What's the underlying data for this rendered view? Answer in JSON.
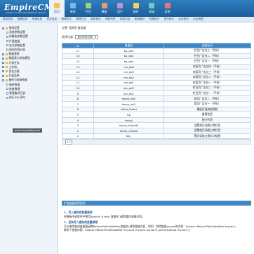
{
  "app": {
    "logo": "EmpireCMS",
    "logo_sub": "Empire Content Management System",
    "topright": ""
  },
  "topnav": [
    {
      "label": "首页",
      "icon": "home-icon",
      "active": true
    },
    {
      "label": "系统",
      "icon": "gear-icon"
    },
    {
      "label": "栏目",
      "icon": "column-icon"
    },
    {
      "label": "模板",
      "icon": "template-icon"
    },
    {
      "label": "用户",
      "icon": "user-icon"
    },
    {
      "label": "插件",
      "icon": "plugin-icon"
    },
    {
      "label": "商城",
      "icon": "shop-icon"
    },
    {
      "label": "其他",
      "icon": "more-icon"
    }
  ],
  "submenu": [
    "增加信息",
    "管理信息",
    "审核信息",
    "签发信息",
    "管理评论",
    "更新栏目",
    "更新首页",
    "更新列表",
    "更新内容",
    "刷新缓存",
    "数据统计",
    "排行统计",
    "后台首页",
    "后台地图"
  ],
  "sidebar": {
    "items": [
      {
        "label": "系统设置",
        "level": 0,
        "kind": "box"
      },
      {
        "label": "系统参数设置",
        "level": 1,
        "kind": "doc"
      },
      {
        "label": "伪静态参数设置",
        "level": 1,
        "kind": "doc"
      },
      {
        "label": "扩展变量",
        "level": 1,
        "kind": "doc"
      },
      {
        "label": "安全参数配置",
        "level": 1,
        "kind": "doc"
      },
      {
        "label": "网站负载分离",
        "level": 1,
        "kind": "doc"
      },
      {
        "label": "数据更新",
        "level": 0,
        "kind": "box"
      },
      {
        "label": "数据表与系统模型",
        "level": 0,
        "kind": "box"
      },
      {
        "label": "计划任务",
        "level": 0,
        "kind": "box"
      },
      {
        "label": "工作流",
        "level": 0,
        "kind": "box"
      },
      {
        "label": "优化方案",
        "level": 0,
        "kind": "box"
      },
      {
        "label": "扩展菜单",
        "level": 0,
        "kind": "box"
      },
      {
        "label": "备份与恢复数据",
        "level": 0,
        "kind": "box"
      },
      {
        "label": "备份数据",
        "level": 1,
        "kind": "doc"
      },
      {
        "label": "恢复数据",
        "level": 1,
        "kind": "doc"
      },
      {
        "label": "管理备份目录",
        "level": 1,
        "kind": "doc"
      },
      {
        "label": "执行SQL语句",
        "level": 1,
        "kind": "doc"
      }
    ],
    "watermark": "www.moyublog.com"
  },
  "main": {
    "breadcrumb": "位置: 管理扩展变量",
    "filter_label": "选择分类:",
    "filter_value": "显示所有分类",
    "columns": [
      "ID",
      "变量名",
      "变量标识"
    ],
    "rows": [
      [
        "17",
        "bo_ad3",
        "栏目广告位三（手机）"
      ],
      [
        "16",
        "bo_ad2",
        "栏目广告位二（手机）"
      ],
      [
        "15",
        "bo_ad1",
        "栏目广告位一（手机）"
      ],
      [
        "14",
        "nei_ad4",
        "内容页广告位四（手机）"
      ],
      [
        "13",
        "nei_ad3",
        "内容页广告位三（手机）"
      ],
      [
        "12",
        "nei_ad2",
        "内容页广告位二（手机）"
      ],
      [
        "11",
        "nei_ad1",
        "内容页广告位一（手机）"
      ],
      [
        "10",
        "lan_ad2",
        "栏目页广告位二（手机）"
      ],
      [
        "9",
        "lan_ad1",
        "栏目页广告位一（手机）"
      ],
      [
        "8",
        "home_ad2",
        "首页广告位二（手机）"
      ],
      [
        "7",
        "home_ad1",
        "首页广告位一（手机）"
      ],
      [
        "6",
        "video_footer",
        "播放页面底部版权"
      ],
      [
        "5",
        "icp",
        "备案信息"
      ],
      [
        "4",
        "tongji",
        "统计代码"
      ],
      [
        "3",
        "home_classid2",
        "设置首页调用分类栏目"
      ],
      [
        "2",
        "home_classid",
        "设置首页调用分类栏目"
      ],
      [
        "1",
        "top_",
        "置站导航右侧文字链接"
      ]
    ],
    "pager": "17"
  },
  "panel": {
    "title": "扩展变量调用说明",
    "line1_head": "1、写入缓存的变量调用",
    "line1": "在模板中或程序中使用$public_r['add_变量名']调用缓存变量内容。",
    "line2_head": "2、没有写入缓存的变量调用",
    "line2": "可以使用查询变量值函数ReturnPublicAddVar(变量名)调用变量内容，例如：取得变量myvar的内容：$value=ReturnPublicAddVar('myvar');",
    "line3": "取多个变量内容：$value=ReturnPublicAddVar('myvar1,myvar2,myvar3');echo $value['myvar1'];"
  }
}
